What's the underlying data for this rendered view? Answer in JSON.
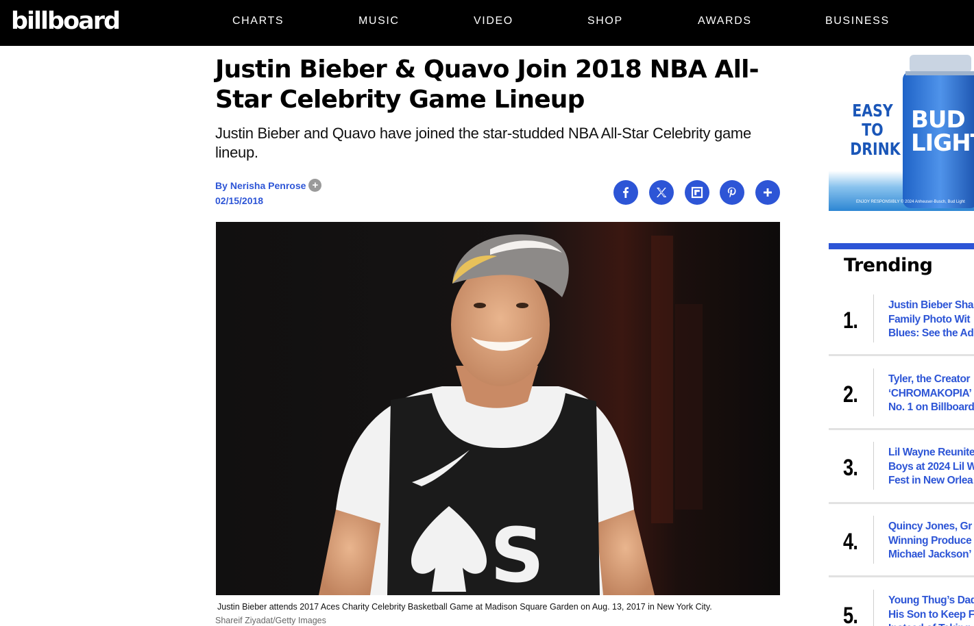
{
  "header": {
    "logo": "billboard",
    "nav": [
      "CHARTS",
      "MUSIC",
      "VIDEO",
      "SHOP",
      "AWARDS",
      "BUSINESS"
    ]
  },
  "article": {
    "headline": "Justin Bieber & Quavo Join 2018 NBA All-Star Celebrity Game Lineup",
    "dek": "Justin Bieber and Quavo have joined the star-studded NBA All-Star Celebrity game lineup.",
    "byline_prefix": "By",
    "author": "Nerisha Penrose",
    "author_follow": "+",
    "date": "02/15/2018",
    "share_icons": [
      "facebook-icon",
      "x-icon",
      "flipboard-icon",
      "pinterest-icon",
      "plus-icon"
    ],
    "photo_caption": "Justin Bieber attends 2017 Aces Charity Celebrity Basketball Game at Madison Square Garden on Aug. 13, 2017 in New York City.",
    "photo_credit": "Shareif Ziyadat/Getty Images"
  },
  "ad": {
    "headline_lines": [
      "EASY",
      "TO",
      "DRINK"
    ],
    "brand_lines": [
      "BUD",
      "LIGHT"
    ],
    "disclaimer": "ENJOY RESPONSIBLY © 2024 Anheuser-Busch, Bud Light"
  },
  "trending": {
    "title": "Trending",
    "items": [
      {
        "rank": "1.",
        "text": "Justin Bieber Sha\nFamily Photo Wit\nBlues: See the Ad"
      },
      {
        "rank": "2.",
        "text": "Tyler, the Creator\n‘CHROMAKOPIA’\nNo. 1 on Billboard"
      },
      {
        "rank": "3.",
        "text": "Lil Wayne Reunite\nBoys at 2024 Lil W\nFest in New Orlea"
      },
      {
        "rank": "4.",
        "text": "Quincy Jones, Gr\nWinning Produce\nMichael Jackson’"
      },
      {
        "rank": "5.",
        "text": "Young Thug’s Dad\nHis Son to Keep F\nInstead of Taking"
      }
    ]
  },
  "colors": {
    "accent": "#2d55d6",
    "header_bg": "#000000",
    "ad_blue": "#1a56b8"
  }
}
